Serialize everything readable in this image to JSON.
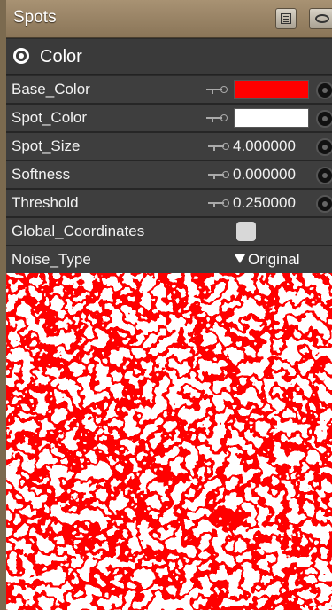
{
  "window": {
    "title": "Spots",
    "list_icon": "list-icon",
    "eye_icon": "eye-icon"
  },
  "section": {
    "label": "Color",
    "icon": "target-icon"
  },
  "properties": [
    {
      "label": "Base_Color",
      "type": "color",
      "color": "#ff0000"
    },
    {
      "label": "Spot_Color",
      "type": "color",
      "color": "#ffffff"
    },
    {
      "label": "Spot_Size",
      "type": "number",
      "value": "4.000000"
    },
    {
      "label": "Softness",
      "type": "number",
      "value": "0.000000"
    },
    {
      "label": "Threshold",
      "type": "number",
      "value": "0.250000"
    },
    {
      "label": "Global_Coordinates",
      "type": "checkbox",
      "checked": false
    },
    {
      "label": "Noise_Type",
      "type": "dropdown",
      "value": "Original"
    }
  ],
  "preview": {
    "spot_color": "#ff0000",
    "background_color": "#ffffff"
  }
}
